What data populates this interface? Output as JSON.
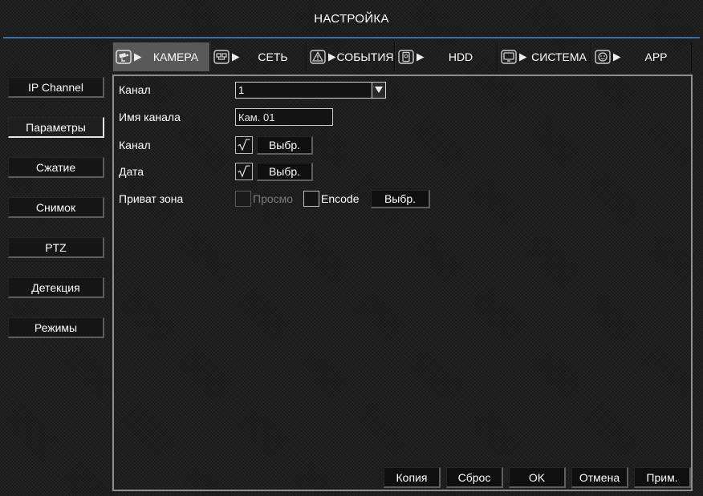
{
  "title": "НАСТРОЙКА",
  "colors": {
    "accent": "#3b6fa8",
    "active_tab": "#595959",
    "panel_border": "#8e8e8e",
    "text": "#ffffff",
    "disabled_text": "#7c7c7c"
  },
  "tabs": [
    {
      "label": "КАМЕРА",
      "icon": "camera-icon",
      "active": true
    },
    {
      "label": "СЕТЬ",
      "icon": "network-icon",
      "active": false
    },
    {
      "label": "СОБЫТИЯ",
      "icon": "alarm-icon",
      "active": false
    },
    {
      "label": "HDD",
      "icon": "hdd-icon",
      "active": false
    },
    {
      "label": "СИСТЕМА",
      "icon": "monitor-icon",
      "active": false
    },
    {
      "label": "APP",
      "icon": "app-icon",
      "active": false
    }
  ],
  "sidebar": {
    "items": [
      {
        "label": "IP Channel",
        "active": false
      },
      {
        "label": "Параметры",
        "active": true
      },
      {
        "label": "Сжатие",
        "active": false
      },
      {
        "label": "Снимок",
        "active": false
      },
      {
        "label": "PTZ",
        "active": false
      },
      {
        "label": "Детекция",
        "active": false
      },
      {
        "label": "Режимы",
        "active": false
      }
    ]
  },
  "form": {
    "channel": {
      "label": "Канал",
      "value": "1",
      "icon": "chevron-down-icon"
    },
    "channel_name": {
      "label": "Имя канала",
      "value": "Кам. 01"
    },
    "channel_title": {
      "label": "Канал",
      "checked": true,
      "button": "Выбр."
    },
    "date": {
      "label": "Дата",
      "checked": true,
      "button": "Выбр."
    },
    "privacy_zone": {
      "label": "Приват зона",
      "preview": {
        "label": "Просмо",
        "checked": false,
        "enabled": false
      },
      "encode": {
        "label": "Encode",
        "checked": false,
        "enabled": true
      },
      "button": "Выбр."
    }
  },
  "footer": {
    "copy": "Копия",
    "reset": "Сброс",
    "ok": "OK",
    "cancel": "Отмена",
    "apply": "Прим."
  }
}
